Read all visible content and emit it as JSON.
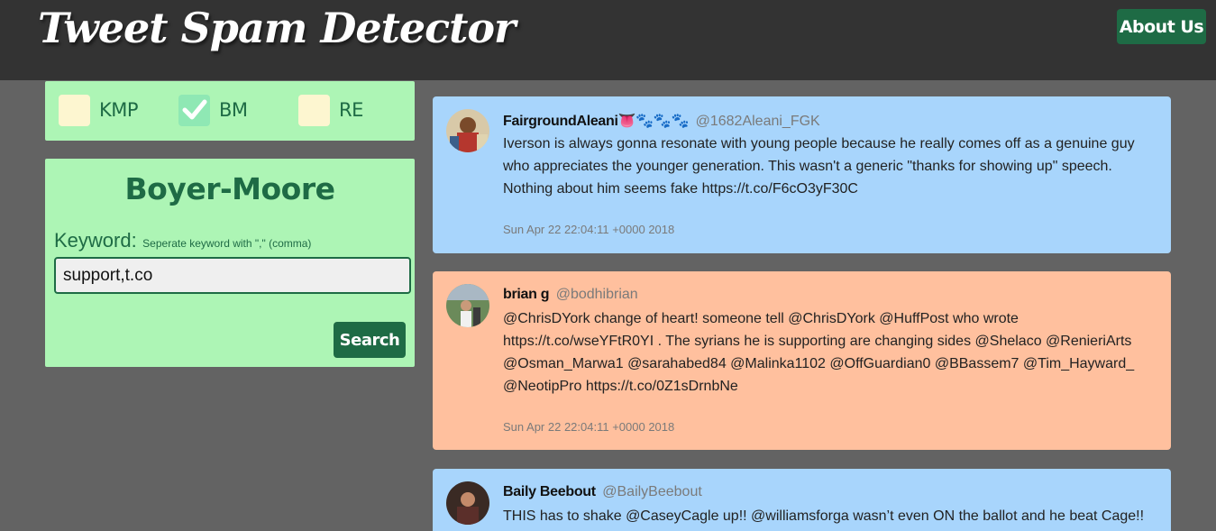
{
  "header": {
    "brand": "Tweet Spam Detector",
    "about_label": "About Us"
  },
  "algorithms": {
    "options": [
      {
        "label": "KMP",
        "checked": false
      },
      {
        "label": "BM",
        "checked": true
      },
      {
        "label": "RE",
        "checked": false
      }
    ]
  },
  "search": {
    "title": "Boyer-Moore",
    "keyword_label": "Keyword:",
    "keyword_hint": "Seperate keyword with \",\" (comma)",
    "keyword_value": "support,t.co",
    "button_label": "Search"
  },
  "tweets": [
    {
      "name": "FairgroundAleani👅🐾🐾🐾",
      "handle": "@1682Aleani_FGK",
      "text": "Iverson is always gonna resonate with young people because he really comes off as a genuine guy who appreciates the younger generation. This wasn't a generic \"thanks for showing up\" speech. Nothing about him seems fake https://t.co/F6cO3yF30C",
      "date": "Sun Apr 22 22:04:11 +0000 2018",
      "status_color": "#a8d5fc"
    },
    {
      "name": "brian g",
      "handle": "@bodhibrian",
      "text": "@ChrisDYork change of heart! someone tell @ChrisDYork @HuffPost who wrote https://t.co/wseYFtR0YI . The syrians he is supporting are changing sides @Shelaco @RenieriArts @Osman_Marwa1 @sarahabed84 @Malinka1102 @OffGuardian0 @BBassem7 @Tim_Hayward_ @NeotipPro https://t.co/0Z1sDrnbNe",
      "date": "Sun Apr 22 22:04:11 +0000 2018",
      "status_color": "#ffc09e"
    },
    {
      "name": "Baily Beebout",
      "handle": "@BailyBeebout",
      "text": "THIS has to shake @CaseyCagle up!! @williamsforga wasn’t even ON the ballot and he beat Cage!!",
      "date": "",
      "status_color": "#a8d5fc"
    }
  ]
}
